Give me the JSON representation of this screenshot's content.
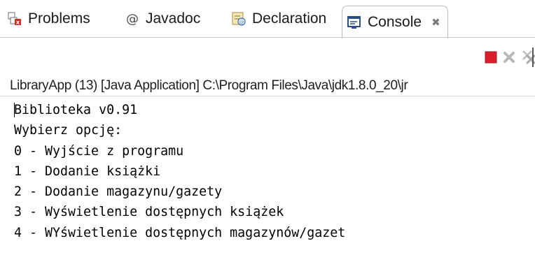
{
  "tabs": [
    {
      "label": "Problems",
      "icon": "problems-icon"
    },
    {
      "label": "Javadoc",
      "icon": "at-icon"
    },
    {
      "label": "Declaration",
      "icon": "declaration-icon"
    },
    {
      "label": "Console",
      "icon": "console-icon",
      "active": true
    }
  ],
  "toolbar": {
    "terminate": "terminate-icon",
    "remove_launch": "remove-launch-icon",
    "remove_all": "remove-all-terminated-icon"
  },
  "launch_description": "LibraryApp (13) [Java Application] C:\\Program Files\\Java\\jdk1.8.0_20\\jr",
  "console": {
    "lines": [
      "Biblioteka v0.91",
      "Wybierz opcję:",
      "0 - Wyjście z programu",
      "1 - Dodanie książki",
      "2 - Dodanie magazynu/gazety",
      "3 - Wyświetlenie dostępnych książek",
      "4 - WYświetlenie dostępnych magazynów/gazet"
    ]
  },
  "colors": {
    "terminate_red": "#d9202a",
    "tab_border": "#b9b9b9",
    "text": "#000000"
  }
}
